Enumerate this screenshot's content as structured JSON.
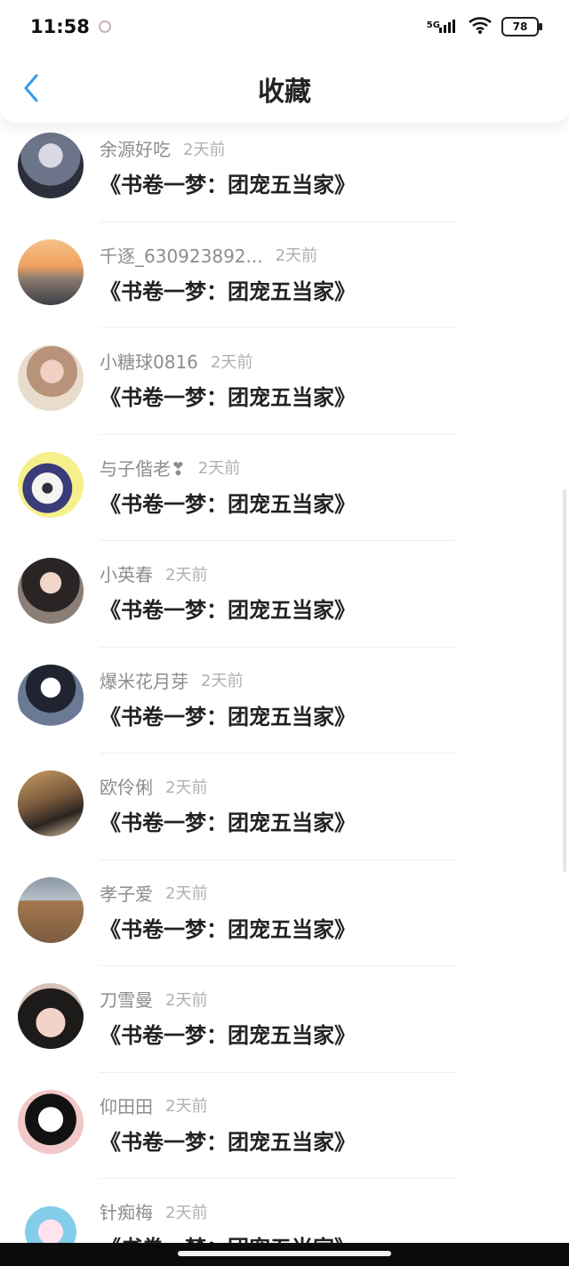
{
  "status_bar": {
    "time": "11:58",
    "network": "5G",
    "battery": "78",
    "icons": [
      "notification-icon",
      "signal-icon",
      "wifi-icon",
      "battery-icon"
    ]
  },
  "header": {
    "title": "收藏",
    "back_icon": "chevron-left-icon"
  },
  "favorites": [
    {
      "user": "余源好吃",
      "time_ago": "2天前",
      "book": "《书卷一梦：团宠五当家》"
    },
    {
      "user": "千逐_630923892...",
      "time_ago": "2天前",
      "book": "《书卷一梦：团宠五当家》"
    },
    {
      "user": "小糖球0816",
      "time_ago": "2天前",
      "book": "《书卷一梦：团宠五当家》"
    },
    {
      "user": "与子偕老❣",
      "time_ago": "2天前",
      "book": "《书卷一梦：团宠五当家》"
    },
    {
      "user": "小英春",
      "time_ago": "2天前",
      "book": "《书卷一梦：团宠五当家》"
    },
    {
      "user": "爆米花月芽",
      "time_ago": "2天前",
      "book": "《书卷一梦：团宠五当家》"
    },
    {
      "user": "欧伶俐",
      "time_ago": "2天前",
      "book": "《书卷一梦：团宠五当家》"
    },
    {
      "user": "孝子爱",
      "time_ago": "2天前",
      "book": "《书卷一梦：团宠五当家》"
    },
    {
      "user": "刀雪曼",
      "time_ago": "2天前",
      "book": "《书卷一梦：团宠五当家》"
    },
    {
      "user": "仰田田",
      "time_ago": "2天前",
      "book": "《书卷一梦：团宠五当家》"
    },
    {
      "user": "针痴梅",
      "time_ago": "2天前",
      "book": "《书卷一梦：团宠五当家》"
    }
  ],
  "colors": {
    "accent": "#2f9df4",
    "text_primary": "#222222",
    "text_secondary": "#8d8d8d",
    "text_tertiary": "#b0b0b0",
    "divider": "#efefef"
  }
}
